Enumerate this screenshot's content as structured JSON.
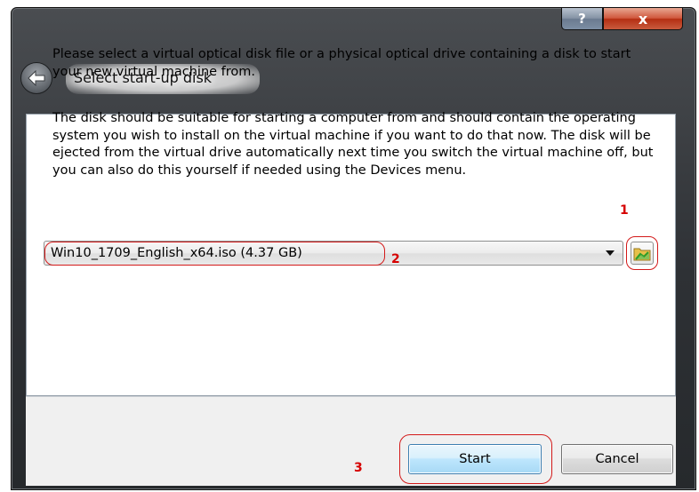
{
  "window": {
    "title": "Select start-up disk",
    "help_label": "?",
    "close_label": "x"
  },
  "intro": {
    "paragraph1": "Please select a virtual optical disk file or a physical optical drive containing a disk to start your new virtual machine from.",
    "paragraph2": "The disk should be suitable for starting a computer from and should contain the operating system you wish to install on the virtual machine if you want to do that now. The disk will be ejected from the virtual drive automatically next time you switch the virtual machine off, but you can also do this yourself if needed using the Devices menu."
  },
  "disk_select": {
    "selected_value": "Win10_1709_English_x64.iso (4.37 GB)"
  },
  "annotations": {
    "n1": "1",
    "n2": "2",
    "n3": "3"
  },
  "buttons": {
    "start": "Start",
    "cancel": "Cancel"
  },
  "icons": {
    "back": "back-arrow-icon",
    "browse": "folder-icon",
    "dropdown": "chevron-down-icon"
  },
  "colors": {
    "annotation_red": "#d31a1a",
    "title_bar": "#2e3135",
    "start_border": "#3c7fb1"
  }
}
